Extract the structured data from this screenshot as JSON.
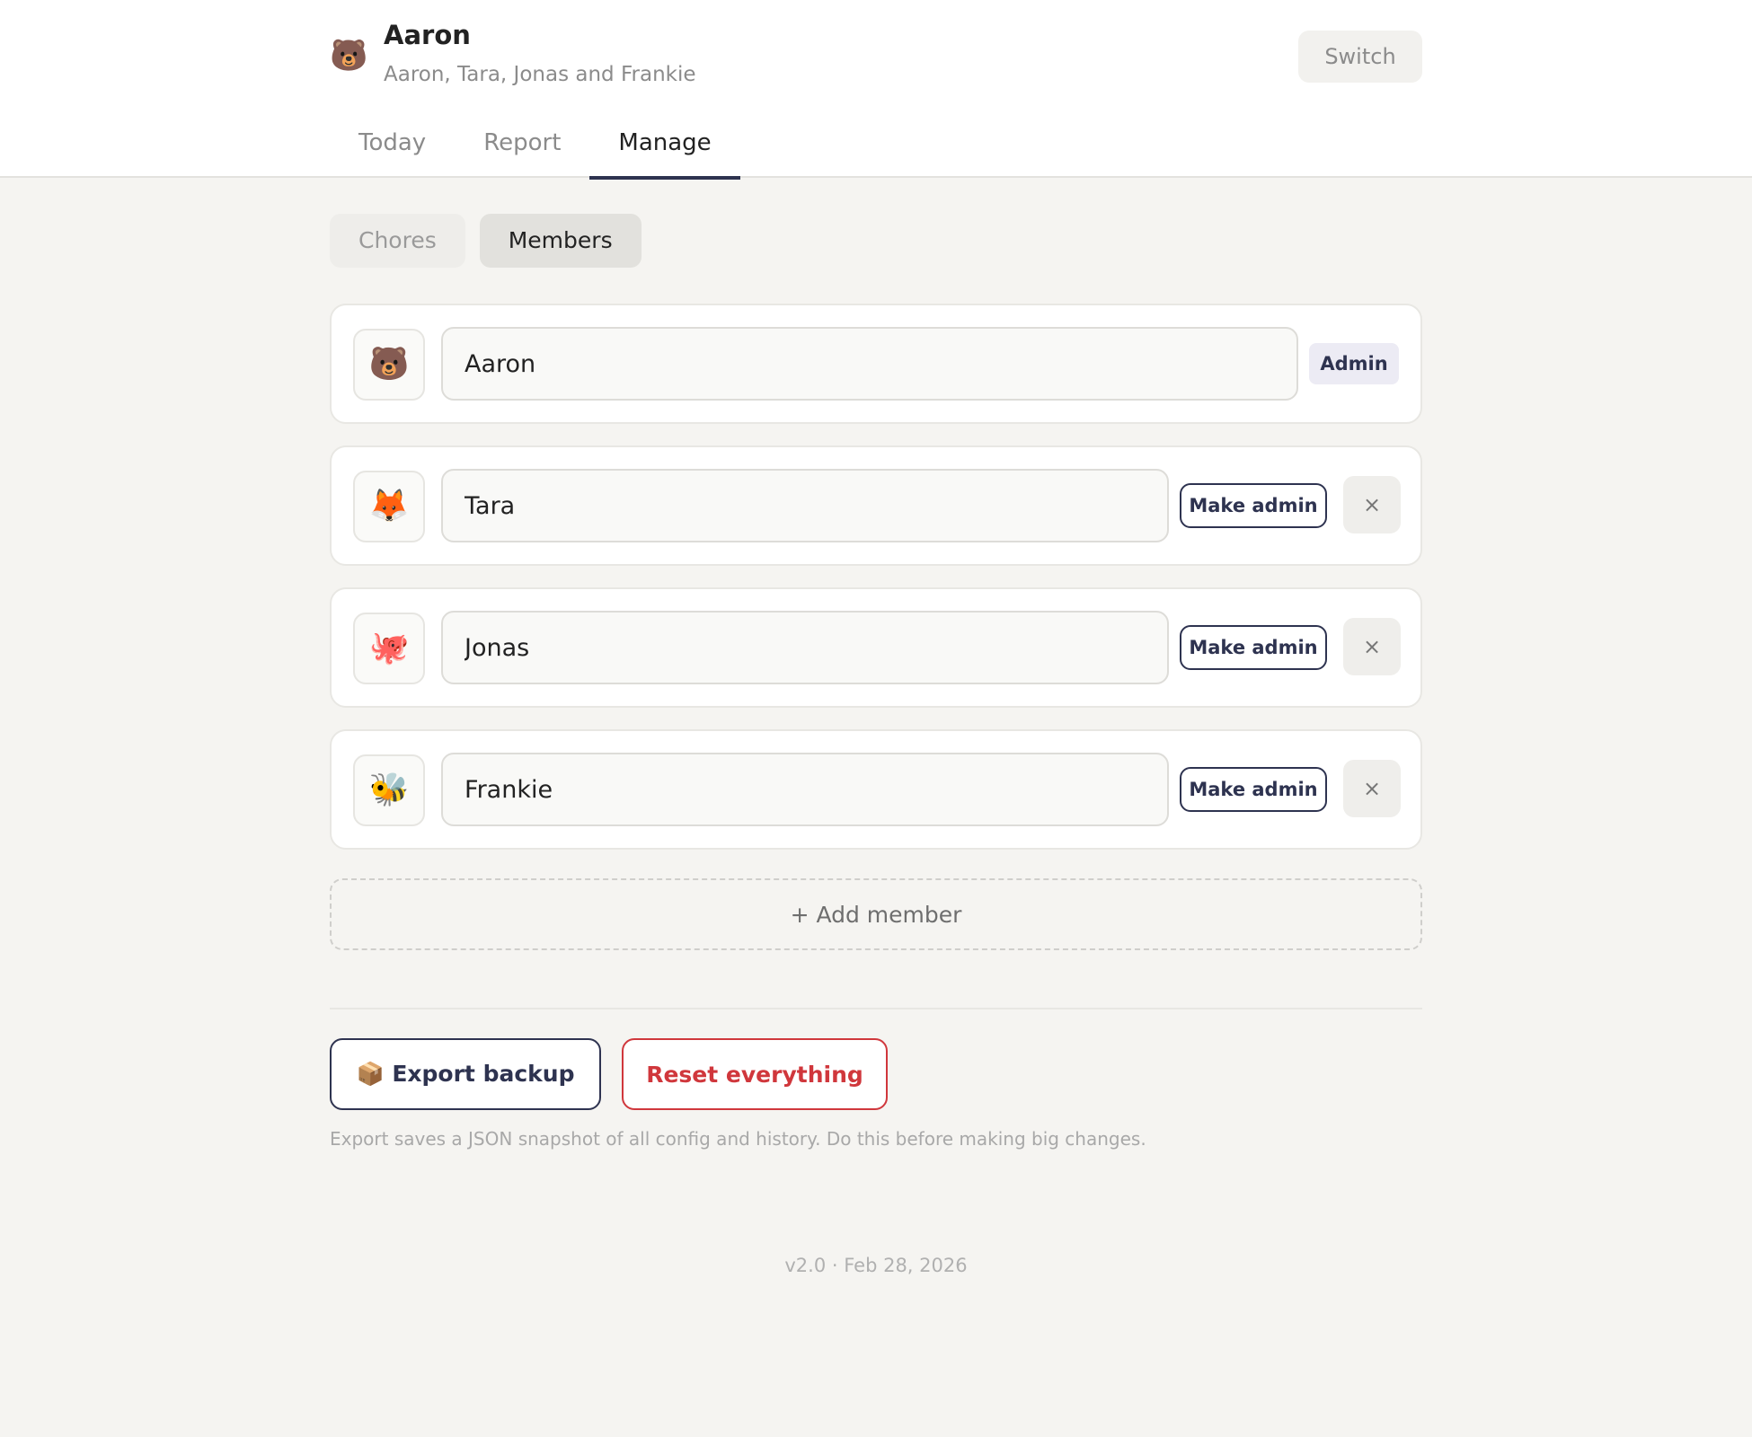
{
  "header": {
    "avatar_emoji": "🐻",
    "user_name": "Aaron",
    "household": "Aaron, Tara, Jonas and Frankie",
    "switch_label": "Switch"
  },
  "tabs": [
    {
      "label": "Today",
      "active": false
    },
    {
      "label": "Report",
      "active": false
    },
    {
      "label": "Manage",
      "active": true
    }
  ],
  "subtabs": [
    {
      "label": "Chores",
      "active": false
    },
    {
      "label": "Members",
      "active": true
    }
  ],
  "members": [
    {
      "emoji": "🐻",
      "name": "Aaron",
      "admin_badge": "Admin"
    },
    {
      "emoji": "🦊",
      "name": "Tara",
      "make_admin": "Make admin",
      "remove": "×"
    },
    {
      "emoji": "🐙",
      "name": "Jonas",
      "make_admin": "Make admin",
      "remove": "×"
    },
    {
      "emoji": "🐝",
      "name": "Frankie",
      "make_admin": "Make admin",
      "remove": "×"
    }
  ],
  "add_member_label": "+ Add member",
  "actions": {
    "export_label": "📦 Export backup",
    "reset_label": "Reset everything",
    "note": "Export saves a JSON snapshot of all config and history. Do this before making big changes."
  },
  "footer": {
    "version": "v2.0 · Feb 28, 2026"
  },
  "colors": {
    "accent": "#2e3350",
    "danger": "#d0373c",
    "background": "#f5f4f1"
  }
}
